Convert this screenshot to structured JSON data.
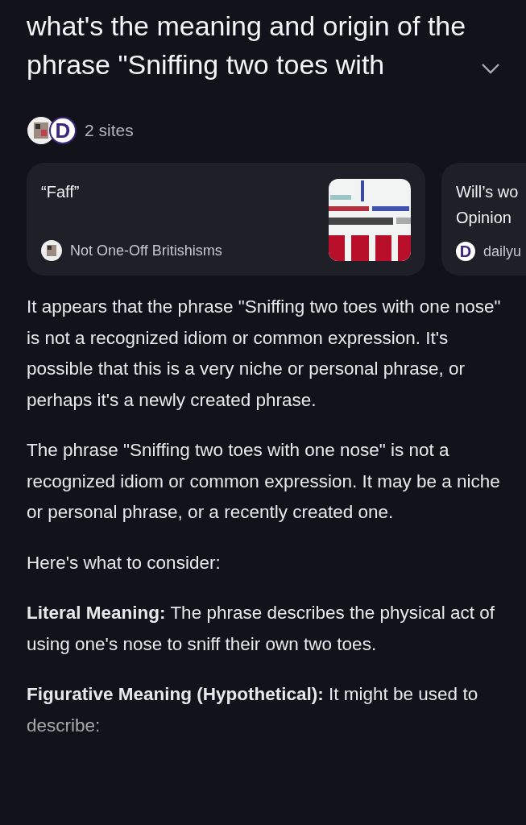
{
  "question": {
    "title": "what's the meaning and origin of the phrase \"Sniffing two toes with",
    "expanded": false
  },
  "sources": {
    "logo_letter": "D",
    "count_label": "2 sites",
    "cards": [
      {
        "title": "“Faff”",
        "site": "Not One-Off Britishisms",
        "kind": "picture"
      },
      {
        "title": "Will’s wo\nOpinion",
        "site": "dailyu",
        "kind": "letter",
        "logo_letter": "D"
      }
    ]
  },
  "answer": [
    "It appears that the phrase \"Sniffing two toes with one nose\" is not a recognized idiom or common expression. It's possible that this is a very niche or personal phrase, or perhaps it's a newly created phrase.",
    "The phrase \"Sniffing two toes with one nose\" is not a recognized idiom or common expression. It may be a niche or personal phrase, or a recently created one.",
    "Here's what to consider:",
    "**Literal Meaning:** The phrase describes the physical act of using one's nose to sniff their own two toes.",
    "**Figurative Meaning (Hypothetical):** It might be used to describe:"
  ]
}
